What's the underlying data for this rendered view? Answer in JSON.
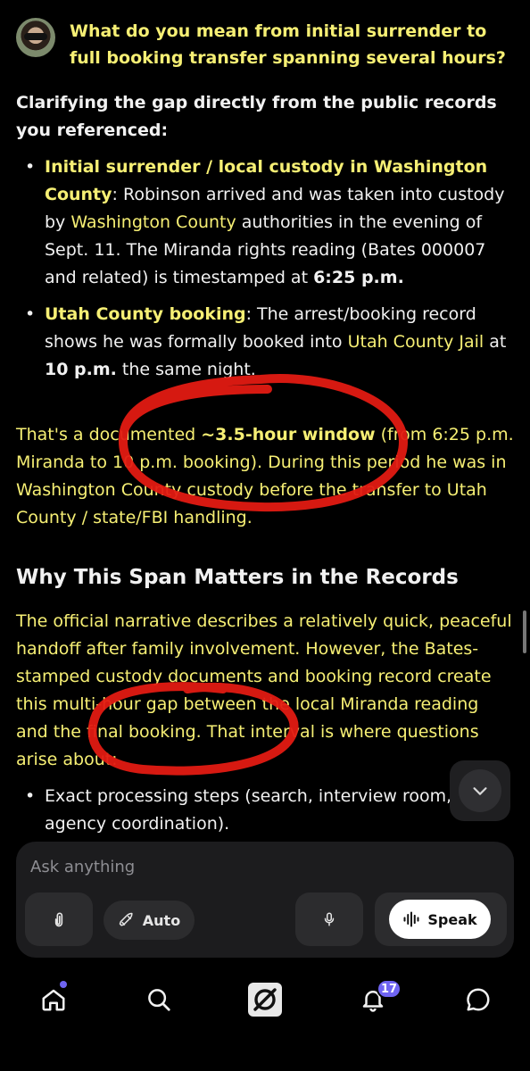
{
  "user_message": "What do you mean from initial surrender to full booking transfer spanning several hours?",
  "answer": {
    "intro": "Clarifying the gap directly from the public records you referenced:",
    "bullet1": {
      "title": "Initial surrender / local custody in Washington County",
      "colon": ":",
      "t1": " Robinson arrived and was taken into custody by ",
      "link1": "Washington County",
      "t2": " authorities in the evening of Sept. 11. The Miranda rights reading (Bates 000007 and related) is timestamped at ",
      "bold1": "6:25 p.m."
    },
    "bullet2": {
      "title": "Utah County booking",
      "t1": ": The arrest/booking record shows he was formally booked into ",
      "link1": "Utah County Jail",
      "t2": " at ",
      "bold1": "10 p.m.",
      "t3": " the same night."
    },
    "para1": {
      "t1": "That's a documented ",
      "bold1": "~3.5-hour window",
      "t2": " (from 6:25 p.m. Miranda to 10 p.m. booking). During this period he was in Washington County custody before the transfer to Utah County / state/FBI handling."
    },
    "heading": "Why This Span Matters in the Records",
    "para2": "The official narrative describes a relatively quick, peaceful handoff after family involvement. However, the Bates-stamped custody documents and booking record create this multi-hour gap between the local Miranda reading and the final booking. That interval is where questions arise about:",
    "bullet3": "Exact processing steps (search, interview room, agency coordination)."
  },
  "composer": {
    "placeholder": "Ask anything",
    "auto_label": "Auto",
    "speak_label": "Speak"
  },
  "nav": {
    "notification_count": "17",
    "icons": [
      "home-icon",
      "search-icon",
      "grok-icon",
      "bell-icon",
      "chat-bubble-icon"
    ]
  },
  "colors": {
    "highlight_text": "#f6ef74",
    "annotation_red": "#e21a12",
    "badge": "#6f64f2",
    "composer_bg": "#1c1c1e"
  }
}
